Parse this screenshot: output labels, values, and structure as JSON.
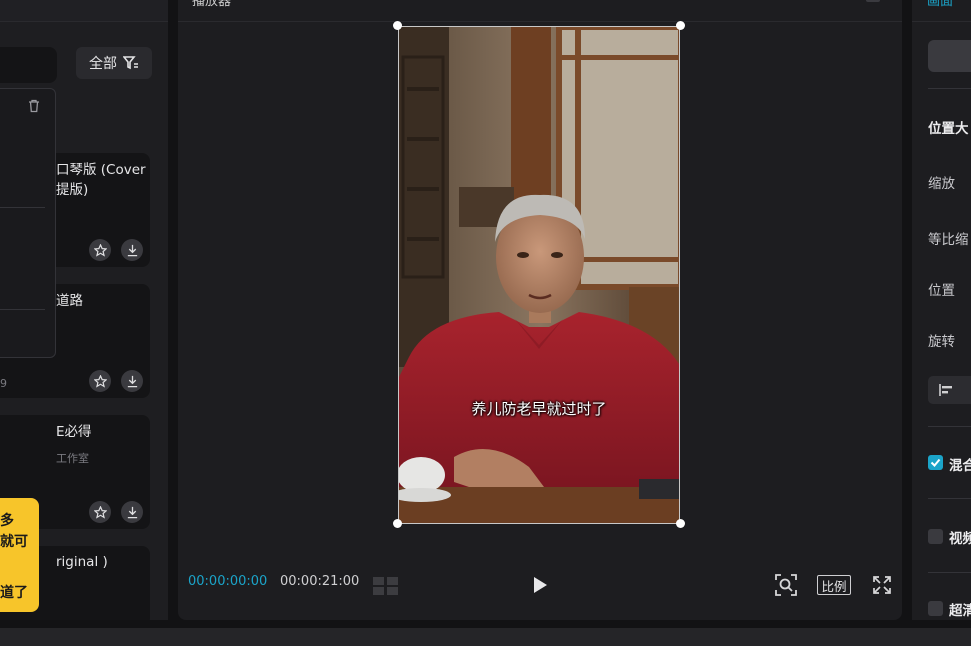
{
  "left_panel": {
    "filter_label": "全部",
    "cards": [
      {
        "title_line1": "口琴版 (Cover",
        "title_line2": "提版)",
        "sub": ""
      },
      {
        "title_line1": "道路",
        "title_line2": "",
        "sub": "9"
      },
      {
        "title_line1": "E必得",
        "title_line2": "",
        "sub": "工作室"
      },
      {
        "title_line1": "riginal )",
        "title_line2": "",
        "sub": ""
      }
    ],
    "tip_lines": [
      "多",
      "就可",
      "",
      "道了"
    ]
  },
  "player": {
    "title": "播放器",
    "subtitle": "养儿防老早就过时了",
    "current_time": "00:00:00:00",
    "total_time": "00:00:21:00",
    "ratio_label": "比例"
  },
  "right_panel": {
    "tab_label": "画面",
    "section_title": "位置大",
    "labels": {
      "scale": "缩放",
      "uniform_scale": "等比缩",
      "position": "位置",
      "rotate": "旋转",
      "blend": "混合",
      "video": "视频",
      "super": "超清"
    }
  },
  "colors": {
    "accent": "#1ba4c9",
    "tip_bg": "#f7c52a",
    "panel_bg": "#1d1d20"
  }
}
